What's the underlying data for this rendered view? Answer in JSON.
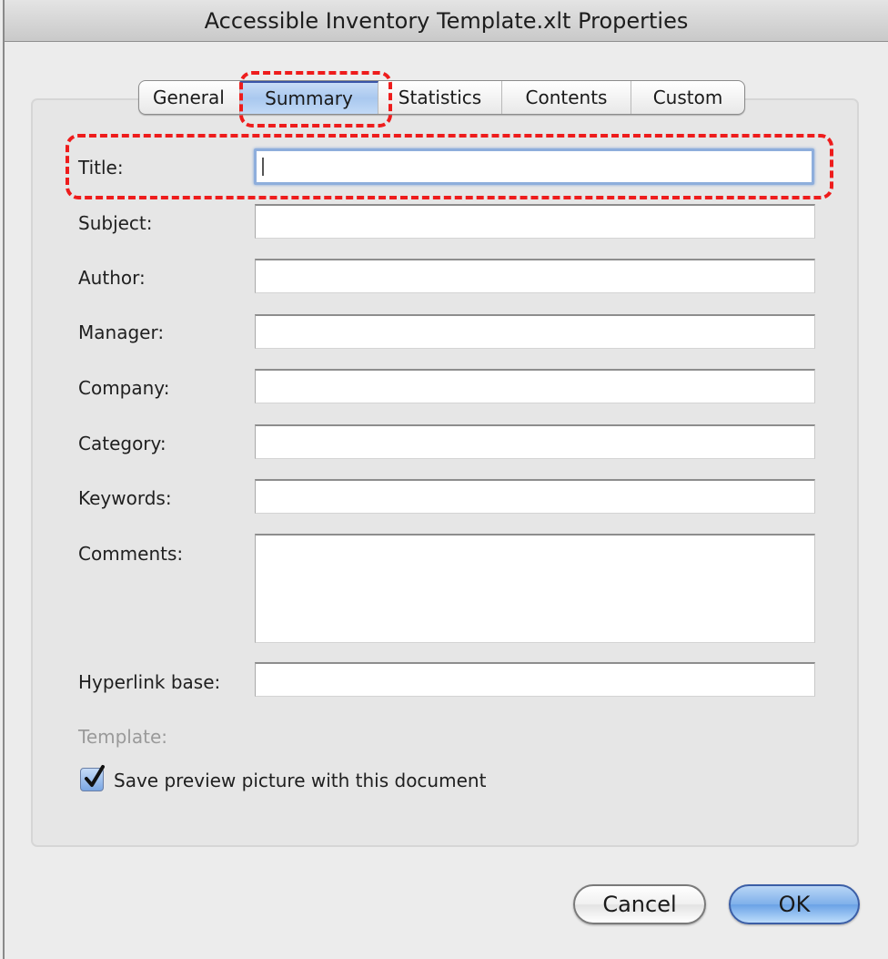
{
  "window": {
    "title": "Accessible Inventory Template.xlt Properties"
  },
  "tabs": [
    {
      "label": "General",
      "active": false
    },
    {
      "label": "Summary",
      "active": true
    },
    {
      "label": "Statistics",
      "active": false
    },
    {
      "label": "Contents",
      "active": false
    },
    {
      "label": "Custom",
      "active": false
    }
  ],
  "fields": {
    "title": {
      "label": "Title:",
      "value": ""
    },
    "subject": {
      "label": "Subject:",
      "value": ""
    },
    "author": {
      "label": "Author:",
      "value": ""
    },
    "manager": {
      "label": "Manager:",
      "value": ""
    },
    "company": {
      "label": "Company:",
      "value": ""
    },
    "category": {
      "label": "Category:",
      "value": ""
    },
    "keywords": {
      "label": "Keywords:",
      "value": ""
    },
    "comments": {
      "label": "Comments:",
      "value": ""
    },
    "hyperlink_base": {
      "label": "Hyperlink base:",
      "value": ""
    },
    "template": {
      "label": "Template:",
      "value": ""
    }
  },
  "save_preview": {
    "label": "Save preview picture with this document",
    "checked": true
  },
  "buttons": {
    "cancel": "Cancel",
    "ok": "OK"
  },
  "colors": {
    "annotation": "#ee1c1c",
    "focus_ring": "#8eaedc",
    "default_button": "#7fb0ea"
  }
}
